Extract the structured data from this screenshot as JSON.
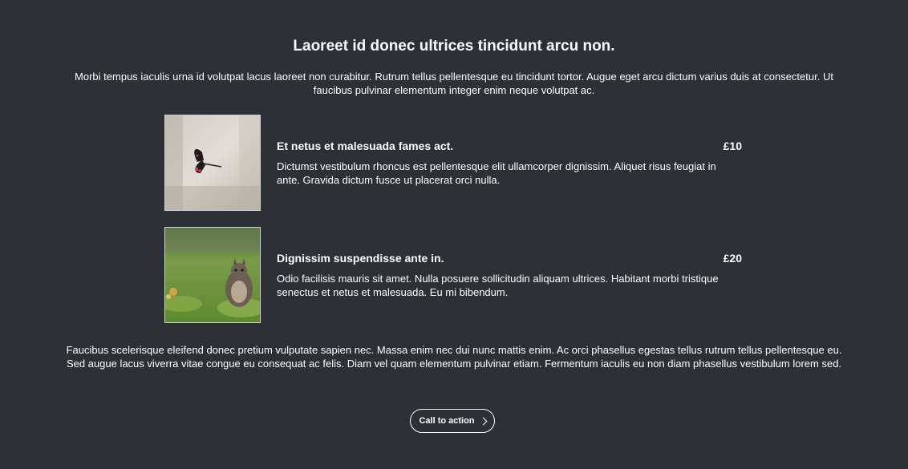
{
  "section": {
    "title": "Laoreet id donec ultrices tincidunt arcu non.",
    "intro": "Morbi tempus iaculis urna id volutpat lacus laoreet non curabitur. Rutrum tellus pellentesque eu tincidunt tortor. Augue eget arcu dictum varius duis at consectetur. Ut faucibus pulvinar elementum integer enim neque volutpat ac.",
    "outro": "Faucibus scelerisque eleifend donec pretium vulputate sapien nec. Massa enim nec dui nunc mattis enim. Ac orci phasellus egestas tellus rutrum tellus pellentesque eu. Sed augue lacus viverra vitae congue eu consequat ac felis. Diam vel quam elementum pulvinar etiam. Fermentum iaculis eu non diam phasellus vestibulum lorem sed."
  },
  "items": [
    {
      "title": "Et netus et malesuada fames act.",
      "price": "£10",
      "description": "Dictumst vestibulum rhoncus est pellentesque elit ullamcorper dignissim. Aliquet risus feugiat in ante. Gravida dictum fusce ut placerat orci nulla.",
      "image_icon": "butterfly-photo"
    },
    {
      "title": "Dignissim suspendisse ante in.",
      "price": "£20",
      "description": "Odio facilisis mauris sit amet. Nulla posuere sollicitudin aliquam ultrices. Habitant morbi tristique senectus et netus et malesuada. Eu mi bibendum.",
      "image_icon": "squirrel-photo"
    }
  ],
  "cta": {
    "label": "Call to action",
    "icon": "chevron-right-icon"
  },
  "colors": {
    "background": "#2d3136",
    "text": "#ffffff"
  }
}
